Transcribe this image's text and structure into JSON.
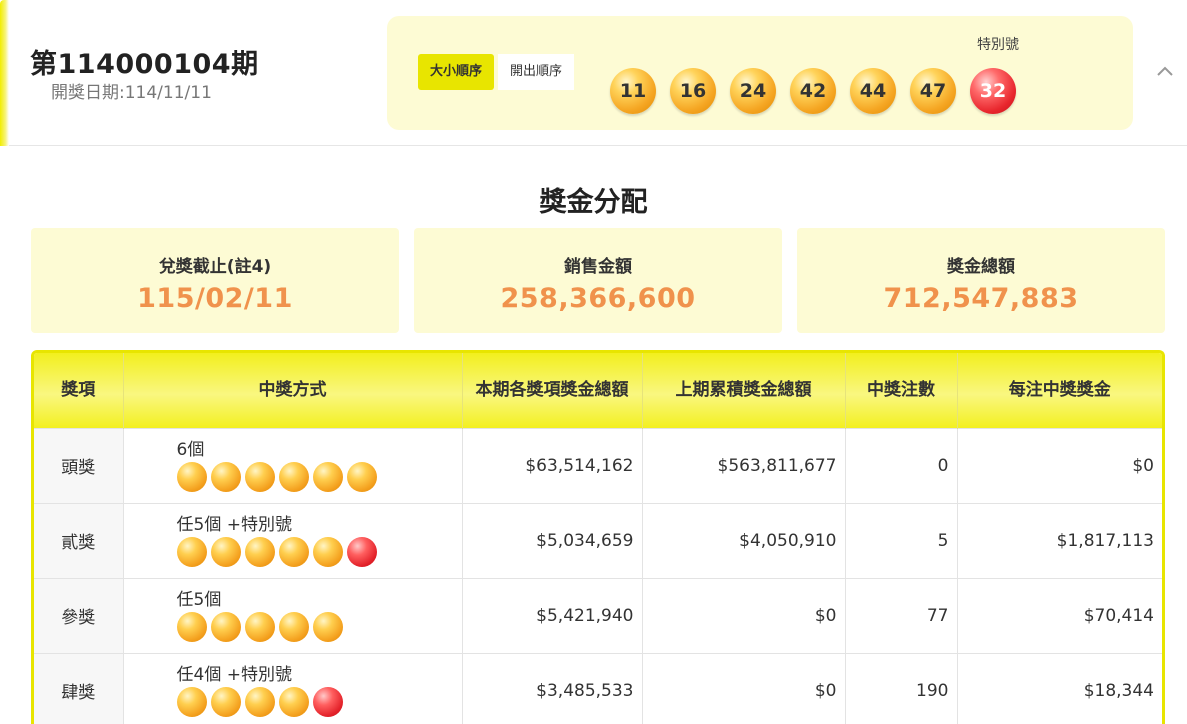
{
  "draw": {
    "title": "第114000104期",
    "date": "開獎日期:114/11/11",
    "sort_tabs": [
      "大小順序",
      "開出順序"
    ],
    "special_label": "特別號",
    "numbers": [
      "11",
      "16",
      "24",
      "42",
      "44",
      "47"
    ],
    "special_number": "32"
  },
  "prize": {
    "section_title": "獎金分配",
    "cards": [
      {
        "label": "兌獎截止(註4)",
        "value": "115/02/11"
      },
      {
        "label": "銷售金額",
        "value": "258,366,600"
      },
      {
        "label": "獎金總額",
        "value": "712,547,883"
      }
    ],
    "headers": [
      "獎項",
      "中獎方式",
      "本期各獎項獎金總額",
      "上期累積獎金總額",
      "中獎注數",
      "每注中獎獎金"
    ],
    "rows": [
      {
        "name": "頭獎",
        "method": "6個",
        "balls": 6,
        "special": false,
        "current": "$63,514,162",
        "previous": "$563,811,677",
        "count": "0",
        "each": "$0"
      },
      {
        "name": "貳獎",
        "method": "任5個 +特別號",
        "balls": 5,
        "special": true,
        "current": "$5,034,659",
        "previous": "$4,050,910",
        "count": "5",
        "each": "$1,817,113"
      },
      {
        "name": "參獎",
        "method": "任5個",
        "balls": 5,
        "special": false,
        "current": "$5,421,940",
        "previous": "$0",
        "count": "77",
        "each": "$70,414"
      },
      {
        "name": "肆獎",
        "method": "任4個 +特別號",
        "balls": 4,
        "special": true,
        "current": "$3,485,533",
        "previous": "$0",
        "count": "190",
        "each": "$18,344"
      }
    ]
  },
  "colors": {
    "accent_yellow": "#e8e500",
    "panel_bg": "#fdfbd4",
    "value_orange": "#f0924c",
    "ball_gold": "#f5a623",
    "ball_red": "#e8262d"
  },
  "icons": {
    "collapse": "chevron-up-icon"
  }
}
